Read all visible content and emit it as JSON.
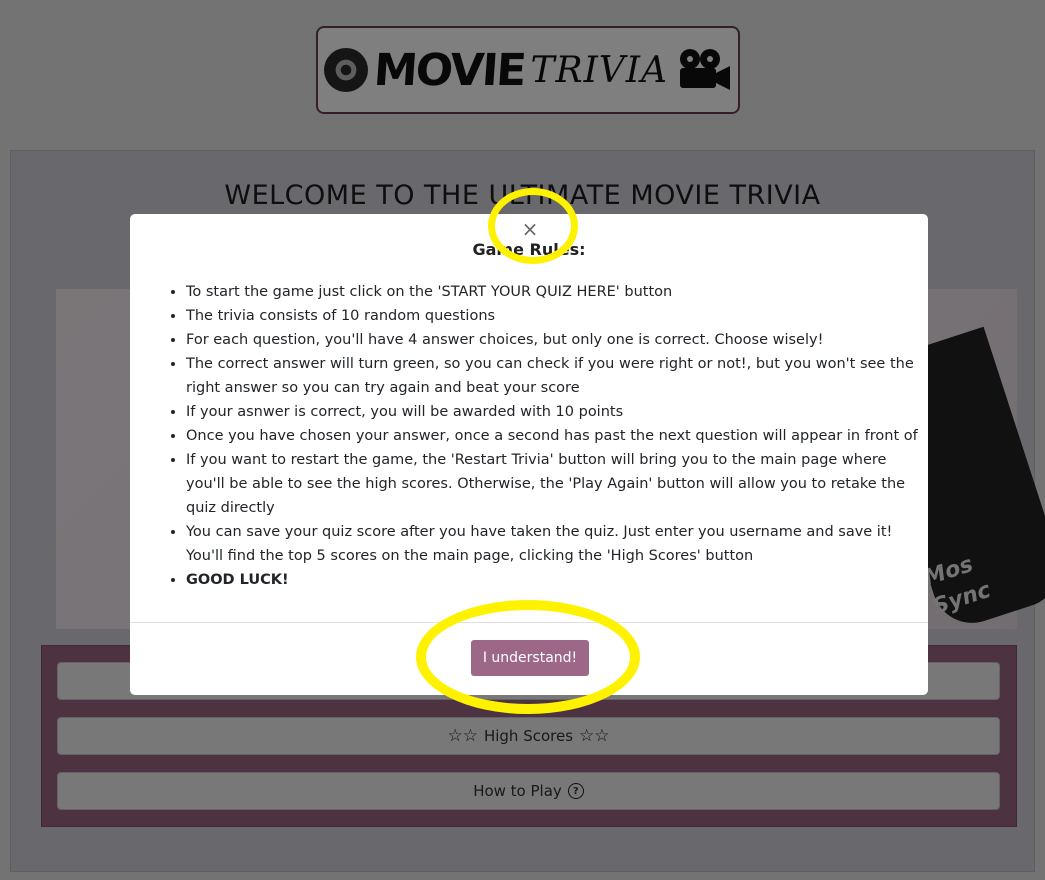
{
  "header": {
    "logo_word1": "MOVIE",
    "logo_word2": "TRIVIA"
  },
  "page": {
    "welcome": "WELCOME TO THE ULTIMATE MOVIE TRIVIA",
    "image_text_line1": "Mos",
    "image_text_line2": "Sync"
  },
  "buttons": {
    "start_label": "",
    "high_scores_label": "High Scores",
    "how_to_play_label": "How to Play"
  },
  "modal": {
    "close_symbol": "×",
    "title": "Game Rules:",
    "rules": [
      "To start the game just click on the 'START YOUR QUIZ HERE' button",
      "The trivia consists of 10 random questions",
      "For each question, you'll have 4 answer choices, but only one is correct. Choose wisely!",
      "The correct answer will turn green, so you can check if you were right or not!, but you won't see the right answer so you can try again and beat your score",
      "If your asnwer is correct, you will be awarded with 10 points",
      "Once you have chosen your answer, once a second has past the next question will appear in front of",
      "If you want to restart the game, the 'Restart Trivia' button will bring you to the main page where you'll be able to see the high scores. Otherwise, the 'Play Again' button will allow you to retake the quiz directly",
      "You can save your quiz score after you have taken the quiz. Just enter you username and save it! You'll find the top 5 scores on the main page, clicking the 'High Scores' button",
      "GOOD LUCK!"
    ],
    "confirm_label": "I understand!"
  },
  "colors": {
    "accent": "#9d6788",
    "highlight": "#fff200",
    "logo_border": "#6b3d58"
  },
  "icons": [
    "film-reel-icon",
    "movie-camera-icon",
    "close-icon",
    "star-outline-icon",
    "question-circle-icon"
  ]
}
